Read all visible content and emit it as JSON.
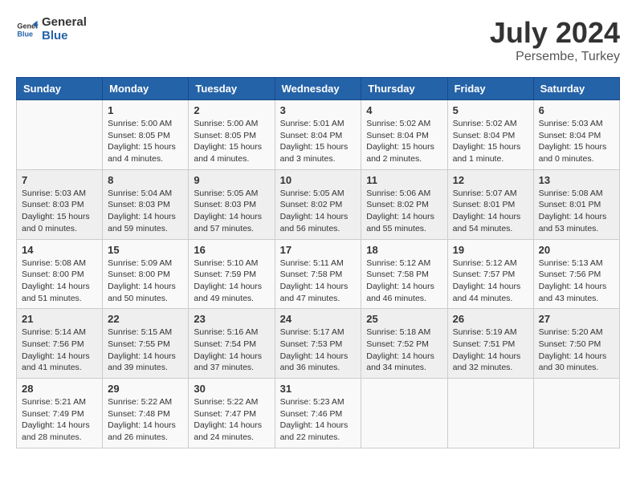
{
  "header": {
    "logo_general": "General",
    "logo_blue": "Blue",
    "month_year": "July 2024",
    "location": "Persembe, Turkey"
  },
  "weekdays": [
    "Sunday",
    "Monday",
    "Tuesday",
    "Wednesday",
    "Thursday",
    "Friday",
    "Saturday"
  ],
  "weeks": [
    [
      {
        "day": "",
        "info": ""
      },
      {
        "day": "1",
        "info": "Sunrise: 5:00 AM\nSunset: 8:05 PM\nDaylight: 15 hours\nand 4 minutes."
      },
      {
        "day": "2",
        "info": "Sunrise: 5:00 AM\nSunset: 8:05 PM\nDaylight: 15 hours\nand 4 minutes."
      },
      {
        "day": "3",
        "info": "Sunrise: 5:01 AM\nSunset: 8:04 PM\nDaylight: 15 hours\nand 3 minutes."
      },
      {
        "day": "4",
        "info": "Sunrise: 5:02 AM\nSunset: 8:04 PM\nDaylight: 15 hours\nand 2 minutes."
      },
      {
        "day": "5",
        "info": "Sunrise: 5:02 AM\nSunset: 8:04 PM\nDaylight: 15 hours\nand 1 minute."
      },
      {
        "day": "6",
        "info": "Sunrise: 5:03 AM\nSunset: 8:04 PM\nDaylight: 15 hours\nand 0 minutes."
      }
    ],
    [
      {
        "day": "7",
        "info": "Sunrise: 5:03 AM\nSunset: 8:03 PM\nDaylight: 15 hours\nand 0 minutes."
      },
      {
        "day": "8",
        "info": "Sunrise: 5:04 AM\nSunset: 8:03 PM\nDaylight: 14 hours\nand 59 minutes."
      },
      {
        "day": "9",
        "info": "Sunrise: 5:05 AM\nSunset: 8:03 PM\nDaylight: 14 hours\nand 57 minutes."
      },
      {
        "day": "10",
        "info": "Sunrise: 5:05 AM\nSunset: 8:02 PM\nDaylight: 14 hours\nand 56 minutes."
      },
      {
        "day": "11",
        "info": "Sunrise: 5:06 AM\nSunset: 8:02 PM\nDaylight: 14 hours\nand 55 minutes."
      },
      {
        "day": "12",
        "info": "Sunrise: 5:07 AM\nSunset: 8:01 PM\nDaylight: 14 hours\nand 54 minutes."
      },
      {
        "day": "13",
        "info": "Sunrise: 5:08 AM\nSunset: 8:01 PM\nDaylight: 14 hours\nand 53 minutes."
      }
    ],
    [
      {
        "day": "14",
        "info": "Sunrise: 5:08 AM\nSunset: 8:00 PM\nDaylight: 14 hours\nand 51 minutes."
      },
      {
        "day": "15",
        "info": "Sunrise: 5:09 AM\nSunset: 8:00 PM\nDaylight: 14 hours\nand 50 minutes."
      },
      {
        "day": "16",
        "info": "Sunrise: 5:10 AM\nSunset: 7:59 PM\nDaylight: 14 hours\nand 49 minutes."
      },
      {
        "day": "17",
        "info": "Sunrise: 5:11 AM\nSunset: 7:58 PM\nDaylight: 14 hours\nand 47 minutes."
      },
      {
        "day": "18",
        "info": "Sunrise: 5:12 AM\nSunset: 7:58 PM\nDaylight: 14 hours\nand 46 minutes."
      },
      {
        "day": "19",
        "info": "Sunrise: 5:12 AM\nSunset: 7:57 PM\nDaylight: 14 hours\nand 44 minutes."
      },
      {
        "day": "20",
        "info": "Sunrise: 5:13 AM\nSunset: 7:56 PM\nDaylight: 14 hours\nand 43 minutes."
      }
    ],
    [
      {
        "day": "21",
        "info": "Sunrise: 5:14 AM\nSunset: 7:56 PM\nDaylight: 14 hours\nand 41 minutes."
      },
      {
        "day": "22",
        "info": "Sunrise: 5:15 AM\nSunset: 7:55 PM\nDaylight: 14 hours\nand 39 minutes."
      },
      {
        "day": "23",
        "info": "Sunrise: 5:16 AM\nSunset: 7:54 PM\nDaylight: 14 hours\nand 37 minutes."
      },
      {
        "day": "24",
        "info": "Sunrise: 5:17 AM\nSunset: 7:53 PM\nDaylight: 14 hours\nand 36 minutes."
      },
      {
        "day": "25",
        "info": "Sunrise: 5:18 AM\nSunset: 7:52 PM\nDaylight: 14 hours\nand 34 minutes."
      },
      {
        "day": "26",
        "info": "Sunrise: 5:19 AM\nSunset: 7:51 PM\nDaylight: 14 hours\nand 32 minutes."
      },
      {
        "day": "27",
        "info": "Sunrise: 5:20 AM\nSunset: 7:50 PM\nDaylight: 14 hours\nand 30 minutes."
      }
    ],
    [
      {
        "day": "28",
        "info": "Sunrise: 5:21 AM\nSunset: 7:49 PM\nDaylight: 14 hours\nand 28 minutes."
      },
      {
        "day": "29",
        "info": "Sunrise: 5:22 AM\nSunset: 7:48 PM\nDaylight: 14 hours\nand 26 minutes."
      },
      {
        "day": "30",
        "info": "Sunrise: 5:22 AM\nSunset: 7:47 PM\nDaylight: 14 hours\nand 24 minutes."
      },
      {
        "day": "31",
        "info": "Sunrise: 5:23 AM\nSunset: 7:46 PM\nDaylight: 14 hours\nand 22 minutes."
      },
      {
        "day": "",
        "info": ""
      },
      {
        "day": "",
        "info": ""
      },
      {
        "day": "",
        "info": ""
      }
    ]
  ]
}
